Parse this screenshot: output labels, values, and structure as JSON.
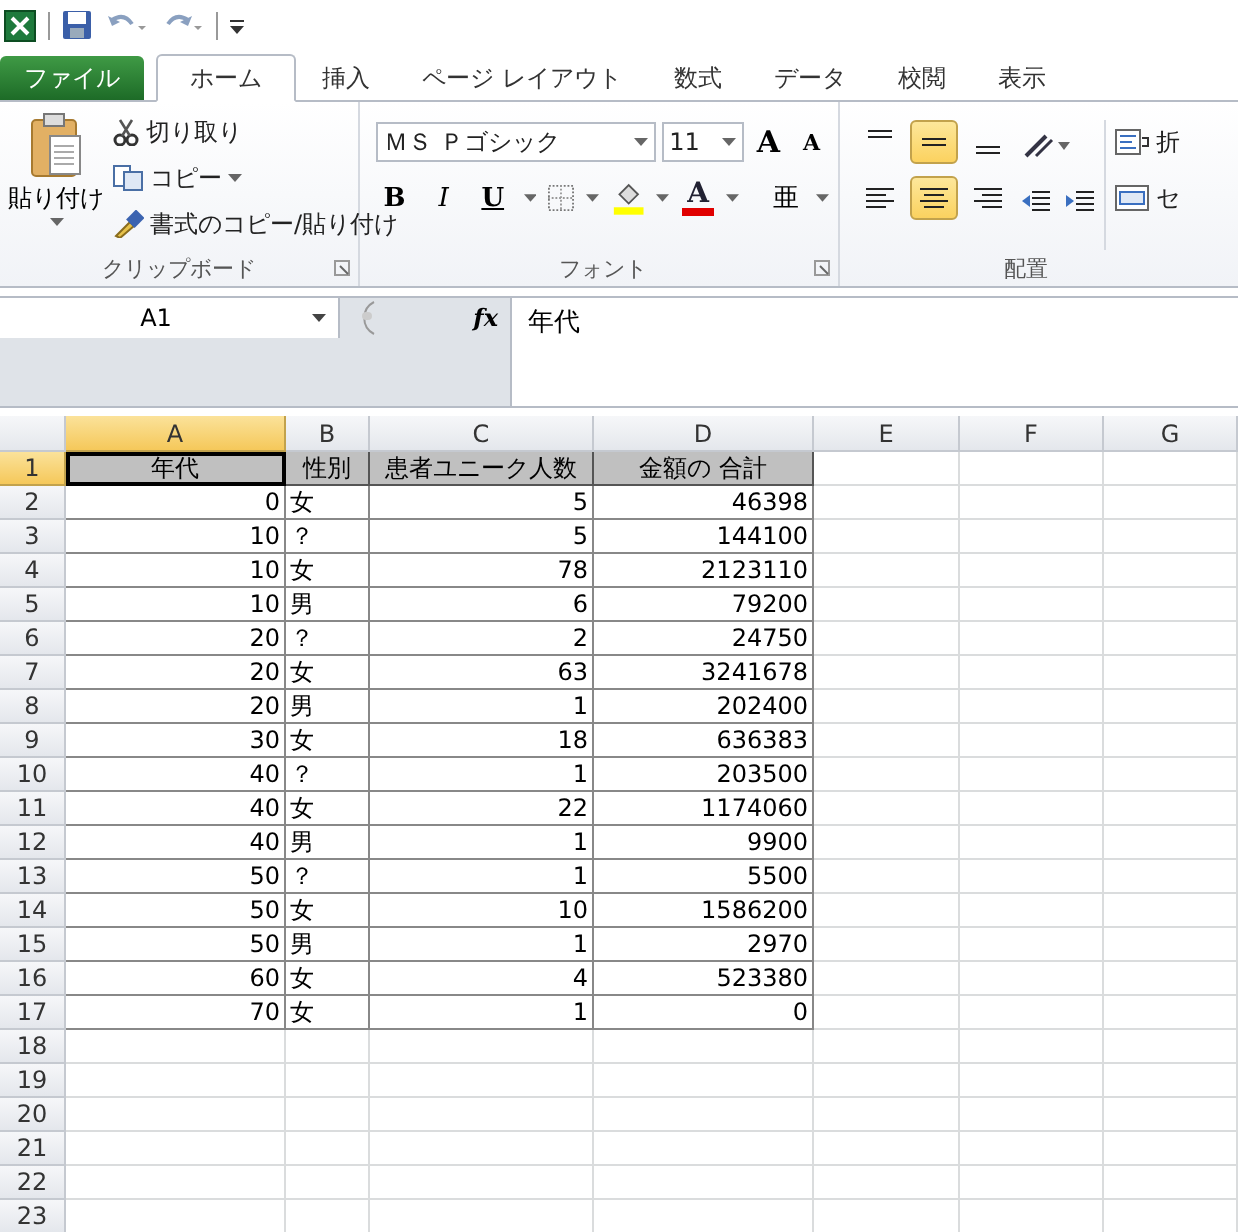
{
  "tabs": [
    {
      "label": "ファイル",
      "kind": "file",
      "selected": false
    },
    {
      "label": "ホーム",
      "kind": "tab",
      "selected": true
    },
    {
      "label": "挿入",
      "kind": "tab",
      "selected": false
    },
    {
      "label": "ページ レイアウト",
      "kind": "tab",
      "selected": false
    },
    {
      "label": "数式",
      "kind": "tab",
      "selected": false
    },
    {
      "label": "データ",
      "kind": "tab",
      "selected": false
    },
    {
      "label": "校閲",
      "kind": "tab",
      "selected": false
    },
    {
      "label": "表示",
      "kind": "tab",
      "selected": false
    }
  ],
  "ribbon": {
    "clipboard": {
      "paste": "貼り付け",
      "cut": "切り取り",
      "copy": "コピー",
      "format_painter": "書式のコピー/貼り付け",
      "label": "クリップボード"
    },
    "font": {
      "name": "ＭＳ Ｐゴシック",
      "size": "11",
      "grow": "A",
      "shrink": "A",
      "bold": "B",
      "italic": "I",
      "underline": "U",
      "font_color": "A",
      "phonetic": "亜",
      "label": "フォント"
    },
    "alignment": {
      "vertical": [
        {
          "selected": false
        },
        {
          "selected": true
        },
        {
          "selected": false
        }
      ],
      "horizontal": [
        {
          "selected": false
        },
        {
          "selected": true
        },
        {
          "selected": false
        }
      ],
      "wrap": "折",
      "merge": "セ",
      "label": "配置"
    }
  },
  "formula_bar": {
    "name_box": "A1",
    "fx": "fx",
    "content": "年代"
  },
  "sheet": {
    "columns": [
      {
        "label": "A",
        "selected": true
      },
      {
        "label": "B",
        "selected": false
      },
      {
        "label": "C",
        "selected": false
      },
      {
        "label": "D",
        "selected": false
      },
      {
        "label": "E",
        "selected": false
      },
      {
        "label": "F",
        "selected": false
      },
      {
        "label": "G",
        "selected": false
      }
    ],
    "rows": [
      {
        "number": "1",
        "selected": true,
        "kind": "header",
        "cells": [
          "年代",
          "性別",
          "患者ユニーク人数",
          "金額の 合計"
        ]
      },
      {
        "number": "2",
        "selected": false,
        "kind": "data",
        "cells": [
          "0",
          "女",
          "5",
          "46398"
        ]
      },
      {
        "number": "3",
        "selected": false,
        "kind": "data",
        "cells": [
          "10",
          "？",
          "5",
          "144100"
        ]
      },
      {
        "number": "4",
        "selected": false,
        "kind": "data",
        "cells": [
          "10",
          "女",
          "78",
          "2123110"
        ]
      },
      {
        "number": "5",
        "selected": false,
        "kind": "data",
        "cells": [
          "10",
          "男",
          "6",
          "79200"
        ]
      },
      {
        "number": "6",
        "selected": false,
        "kind": "data",
        "cells": [
          "20",
          "？",
          "2",
          "24750"
        ]
      },
      {
        "number": "7",
        "selected": false,
        "kind": "data",
        "cells": [
          "20",
          "女",
          "63",
          "3241678"
        ]
      },
      {
        "number": "8",
        "selected": false,
        "kind": "data",
        "cells": [
          "20",
          "男",
          "1",
          "202400"
        ]
      },
      {
        "number": "9",
        "selected": false,
        "kind": "data",
        "cells": [
          "30",
          "女",
          "18",
          "636383"
        ]
      },
      {
        "number": "10",
        "selected": false,
        "kind": "data",
        "cells": [
          "40",
          "？",
          "1",
          "203500"
        ]
      },
      {
        "number": "11",
        "selected": false,
        "kind": "data",
        "cells": [
          "40",
          "女",
          "22",
          "1174060"
        ]
      },
      {
        "number": "12",
        "selected": false,
        "kind": "data",
        "cells": [
          "40",
          "男",
          "1",
          "9900"
        ]
      },
      {
        "number": "13",
        "selected": false,
        "kind": "data",
        "cells": [
          "50",
          "？",
          "1",
          "5500"
        ]
      },
      {
        "number": "14",
        "selected": false,
        "kind": "data",
        "cells": [
          "50",
          "女",
          "10",
          "1586200"
        ]
      },
      {
        "number": "15",
        "selected": false,
        "kind": "data",
        "cells": [
          "50",
          "男",
          "1",
          "2970"
        ]
      },
      {
        "number": "16",
        "selected": false,
        "kind": "data",
        "cells": [
          "60",
          "女",
          "4",
          "523380"
        ]
      },
      {
        "number": "17",
        "selected": false,
        "kind": "data",
        "cells": [
          "70",
          "女",
          "1",
          "0"
        ]
      },
      {
        "number": "18",
        "selected": false,
        "kind": "empty",
        "cells": []
      },
      {
        "number": "19",
        "selected": false,
        "kind": "empty",
        "cells": []
      },
      {
        "number": "20",
        "selected": false,
        "kind": "empty",
        "cells": []
      },
      {
        "number": "21",
        "selected": false,
        "kind": "empty",
        "cells": []
      },
      {
        "number": "22",
        "selected": false,
        "kind": "empty",
        "cells": []
      },
      {
        "number": "23",
        "selected": false,
        "kind": "empty",
        "cells": []
      }
    ]
  }
}
